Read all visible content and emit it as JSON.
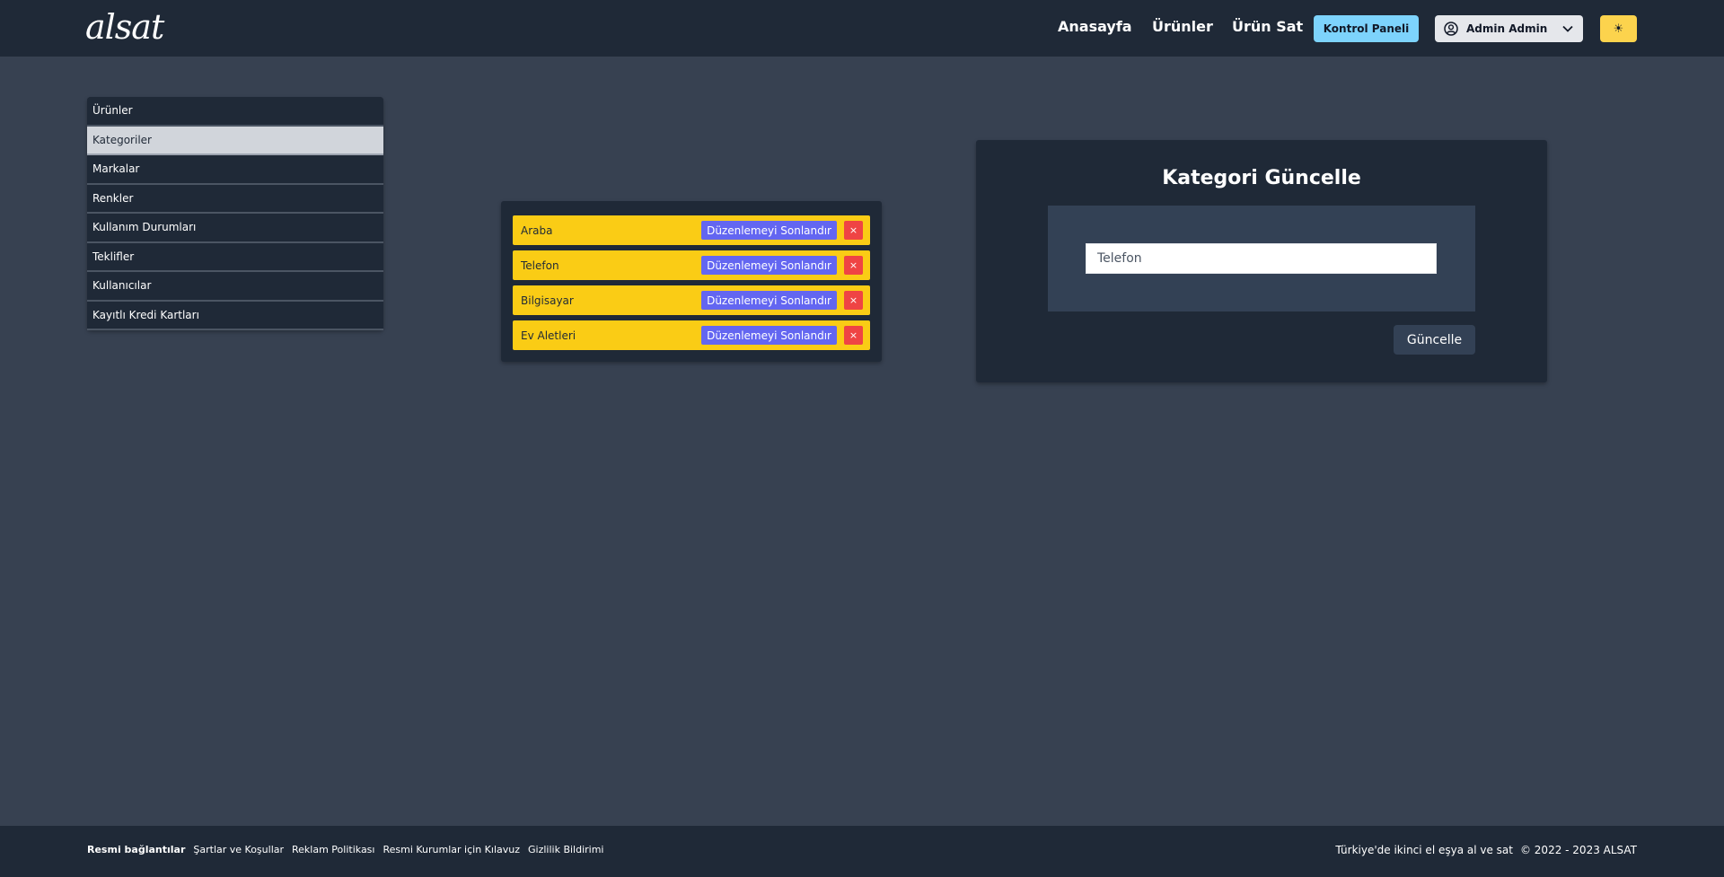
{
  "header": {
    "logo": "alsat",
    "nav": {
      "home": "Anasayfa",
      "products": "Ürünler",
      "sell": "Ürün Sat"
    },
    "control_panel": "Kontrol Paneli",
    "user_name": "Admin Admin",
    "user_icon": "user-circle-icon",
    "dropdown_icon": "chevron-down-icon",
    "theme_icon": "☀"
  },
  "sidebar": {
    "items": [
      {
        "label": "Ürünler"
      },
      {
        "label": "Kategoriler"
      },
      {
        "label": "Markalar"
      },
      {
        "label": "Renkler"
      },
      {
        "label": "Kullanım Durumları"
      },
      {
        "label": "Teklifler"
      },
      {
        "label": "Kullanıcılar"
      },
      {
        "label": "Kayıtlı Kredi Kartları"
      }
    ],
    "active_index": 1
  },
  "categories": {
    "items": [
      {
        "name": "Araba",
        "action": "Düzenlemeyi Sonlandır",
        "delete": "×"
      },
      {
        "name": "Telefon",
        "action": "Düzenlemeyi Sonlandır",
        "delete": "×"
      },
      {
        "name": "Bilgisayar",
        "action": "Düzenlemeyi Sonlandır",
        "delete": "×"
      },
      {
        "name": "Ev Aletleri",
        "action": "Düzenlemeyi Sonlandır",
        "delete": "×"
      }
    ]
  },
  "update_form": {
    "title": "Kategori Güncelle",
    "input_value": "Telefon",
    "submit_label": "Güncelle"
  },
  "footer": {
    "links_title": "Resmi bağlantılar",
    "links": [
      "Şartlar ve Koşullar",
      "Reklam Politikası",
      "Resmi Kurumlar için Kılavuz",
      "Gizlilik Bildirimi"
    ],
    "tagline": "Türkiye'de ikinci el eşya al ve sat",
    "copyright": "© 2022 - 2023 ALSAT"
  },
  "colors": {
    "background": "#374151",
    "header": "#1f2937",
    "category_row": "#facc15",
    "finish_button": "#6366f1",
    "delete_button": "#ef4444",
    "control_panel_button": "#7dd3fc",
    "theme_button": "#fcd34d"
  }
}
